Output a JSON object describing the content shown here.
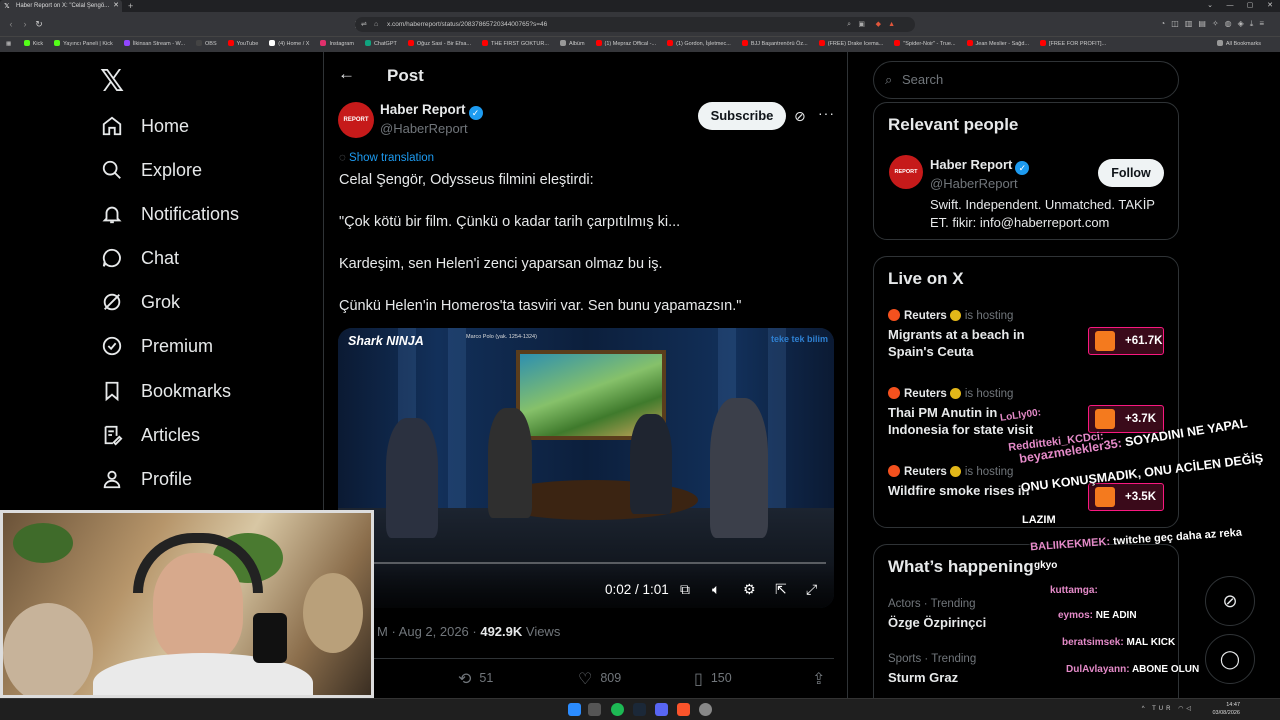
{
  "browser": {
    "tab_title": "Haber Report on X: \"Celal Şengö...",
    "url": "x.com/haberreport/status/2083786572034400765?s=46",
    "bookmarks": [
      "Kick",
      "Yayıncı Paneli | Kick",
      "İlkinsan Stream - W...",
      "OBS",
      "YouTube",
      "(4) Home / X",
      "Instagram",
      "ChatGPT",
      "Oğuz Sasi - Bir Efsa...",
      "THE FIRST GOKTUR...",
      "Albüm",
      "(1) Mepraz Offical -...",
      "(1) Gordon, İşletmec...",
      "BJJ Başantrenörü Öz...",
      "(FREE) Drake Icema...",
      "\"Spider-Noir\" - True...",
      "Jean Meslier - Sağd...",
      "[FREE FOR PROFIT]..."
    ],
    "all_bookmarks": "All Bookmarks"
  },
  "nav": {
    "items": [
      {
        "label": "Home",
        "icon": "home-icon"
      },
      {
        "label": "Explore",
        "icon": "search-icon"
      },
      {
        "label": "Notifications",
        "icon": "bell-icon"
      },
      {
        "label": "Chat",
        "icon": "chat-icon"
      },
      {
        "label": "Grok",
        "icon": "grok-icon"
      },
      {
        "label": "Premium",
        "icon": "premium-icon"
      },
      {
        "label": "Bookmarks",
        "icon": "bookmark-icon"
      },
      {
        "label": "Articles",
        "icon": "articles-icon"
      },
      {
        "label": "Profile",
        "icon": "profile-icon"
      }
    ]
  },
  "post": {
    "header_title": "Post",
    "author_name": "Haber Report",
    "author_handle": "@HaberReport",
    "avatar_text": "REPORT",
    "subscribe_label": "Subscribe",
    "show_translation": "Show translation",
    "lines": [
      "Celal Şengör, Odysseus filmini eleştirdi:",
      "\"Çok kötü bir film. Çünkü o kadar tarih çarpıtılmış ki...",
      "Kardeşim, sen Helen'i zenci yaparsan olmaz bu iş.",
      "Çünkü Helen'in Homeros'ta tasviri var. Sen bunu yapamazsın.\""
    ],
    "video": {
      "brand": "Shark NINJA",
      "caption": "Marco Polo (yak. 1254-1324)",
      "corner_logo": "teke tek bilim",
      "time": "0:02 / 1:01",
      "progress": 0.033
    },
    "meta_time": "M · Aug 2, 2026 · ",
    "views": "492.9K",
    "views_label": " Views",
    "reposts": "51",
    "likes": "809",
    "bookmarks": "150"
  },
  "right": {
    "search_placeholder": "Search",
    "relevant_title": "Relevant people",
    "relevant": {
      "name": "Haber Report",
      "handle": "@HaberReport",
      "avatar_text": "REPORT",
      "follow_label": "Follow",
      "bio": "Swift. Independent. Unmatched. TAKİP ET. fikir: info@haberreport.com"
    },
    "live_title": "Live on X",
    "live": [
      {
        "host": "Reuters",
        "status": "is hosting",
        "title": "Migrants at a beach in Spain's Ceuta",
        "count": "+61.7K"
      },
      {
        "host": "Reuters",
        "status": "is hosting",
        "title": "Thai PM Anutin in Indonesia for state visit",
        "count": "+3.7K"
      },
      {
        "host": "Reuters",
        "status": "is hosting",
        "title": "Wildfire smoke rises in",
        "count": "+3.5K"
      }
    ],
    "happening_title": "What’s happening",
    "trends": [
      {
        "category": "Actors · Trending",
        "name": "Özge Özpirinçci"
      },
      {
        "category": "Sports · Trending",
        "name": "Sturm Graz"
      }
    ]
  },
  "chat_overlay": [
    {
      "user": "LoLly00:",
      "msg": ""
    },
    {
      "user": "Redditteki_KCDci:",
      "msg": ""
    },
    {
      "user": "beyazmelekler35:",
      "msg": "SOYADINI NE YAPAL"
    },
    {
      "user": "",
      "msg": "ONU KONUŞMADIK, ONU ACİLEN DEĞİŞ"
    },
    {
      "user": "",
      "msg": "LAZIM"
    },
    {
      "user": "BALIIKEKMEK:",
      "msg": "twitche geç daha az reka"
    },
    {
      "user": "",
      "msg": "gkyo"
    },
    {
      "user": "kuttamga:",
      "msg": ""
    },
    {
      "user": "eymos:",
      "msg": "NE ADIN"
    },
    {
      "user": "beratsimsek:",
      "msg": "MAL KICK"
    },
    {
      "user": "DulAvlayann:",
      "msg": "ABONE OLUN"
    }
  ],
  "taskbar": {
    "lang": "TUR",
    "time": "14:47",
    "date": "03/08/2026"
  },
  "colors": {
    "accent": "#1d9bf0",
    "background": "#000000",
    "border": "#2f3336",
    "live_badge": "#f91880",
    "chat_user": "#e48ac8"
  }
}
